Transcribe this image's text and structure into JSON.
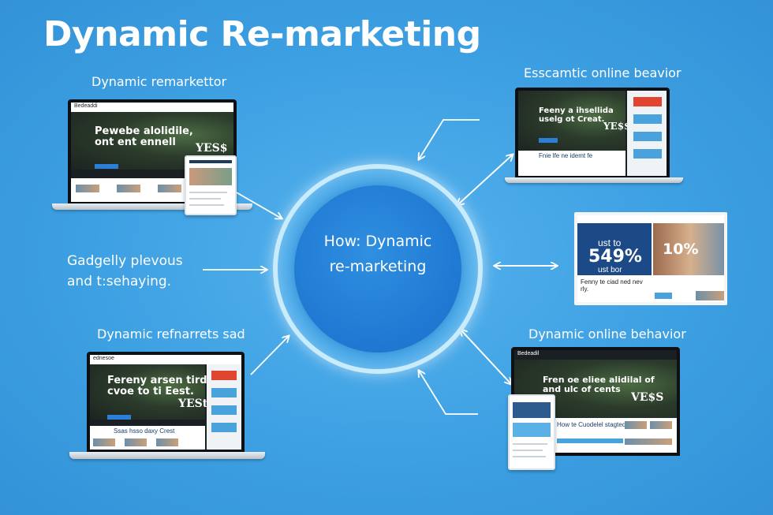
{
  "title": "Dynamic Re-marketing",
  "center": {
    "line1": "How: Dynamic",
    "line2": "re-marketing"
  },
  "labels": {
    "top_left": "Dynamic remarkettor",
    "middle_left_1": "Gadgelly plevous",
    "middle_left_2": "and t:sehaying.",
    "bottom_left": "Dynamic refnarrets sad",
    "top_right": "Esscamtic online beavior",
    "bottom_right": "Dynamic online behavior"
  },
  "devices": {
    "top_left": {
      "logo": "Bedeaddi",
      "hero_line1": "Pewebe alolidile,",
      "hero_line2": "ont ent ennell",
      "badge": "YES$"
    },
    "top_right": {
      "logo": "",
      "hero_line1": "Feeny a ihsellida",
      "hero_line2": "uselg ot Creat.",
      "badge": "YE$$",
      "footer": "Fnie lfe ne idemt fe"
    },
    "middle_right": {
      "promo_line1": "ust to",
      "promo_big": "549%",
      "promo_line3": "ust bor",
      "side_promo": "10%",
      "footer": "Fenny te ciad ned nev rly."
    },
    "bottom_left": {
      "logo": "ednesoe",
      "hero_line1": "Fereny arsen tird",
      "hero_line2": "cvoe to ti Eest.",
      "badge": "YESt",
      "footer": "Ssas hsso daxy Crest"
    },
    "bottom_right": {
      "logo": "Bedeadil",
      "hero_line1": "Fren oe eliee alidilal of",
      "hero_line2": "and ulc of cents",
      "badge": "VE$S",
      "footer": "How te Cuodelel stagtedes"
    }
  },
  "colors": {
    "background": "#3fa3e3",
    "circle_ring": "#c8ecfb",
    "circle_fill": "#1f78d2",
    "cta_blue": "#2c7fd6",
    "promo_red": "#e2452f"
  }
}
